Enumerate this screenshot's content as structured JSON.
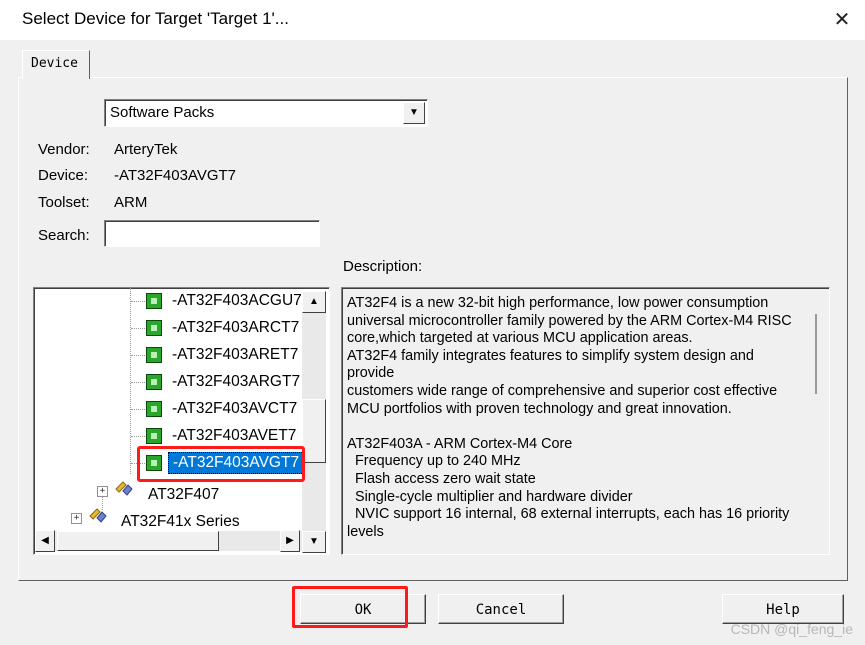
{
  "window": {
    "title": "Select Device for Target 'Target 1'...",
    "close_glyph": "✕"
  },
  "tab": {
    "label": "Device"
  },
  "source_select": {
    "value": "Software Packs"
  },
  "info": {
    "vendor_label": "Vendor:",
    "vendor": "ArteryTek",
    "device_label": "Device:",
    "device": "-AT32F403AVGT7",
    "toolset_label": "Toolset:",
    "toolset": "ARM",
    "search_label": "Search:",
    "search_value": ""
  },
  "tree": {
    "devices": [
      "-AT32F403ACGU7",
      "-AT32F403ARCT7",
      "-AT32F403ARET7",
      "-AT32F403ARGT7",
      "-AT32F403AVCT7",
      "-AT32F403AVET7",
      "-AT32F403AVGT7"
    ],
    "selected": "-AT32F403AVGT7",
    "families": [
      "AT32F407",
      "AT32F41x Series"
    ]
  },
  "description": {
    "label": "Description:",
    "text": "AT32F4 is a new 32-bit high performance, low power consumption\nuniversal microcontroller family powered by the ARM Cortex-M4 RISC\ncore,which targeted at various MCU application areas.\nAT32F4 family integrates features to simplify system design and provide\ncustomers wide range of comprehensive and superior cost effective\nMCU portfolios with proven technology and great innovation.\n\nAT32F403A - ARM Cortex-M4 Core\n  Frequency up to 240 MHz\n  Flash access zero wait state\n  Single-cycle multiplier and hardware divider\n  NVIC support 16 internal, 68 external interrupts, each has 16 priority\nlevels"
  },
  "buttons": {
    "ok": "OK",
    "cancel": "Cancel",
    "help": "Help"
  },
  "watermark": "CSDN @qi_feng_ie",
  "colors": {
    "selection": "#0078d7",
    "highlight_box": "#ff1a1a",
    "chip": "#2aa62a"
  }
}
